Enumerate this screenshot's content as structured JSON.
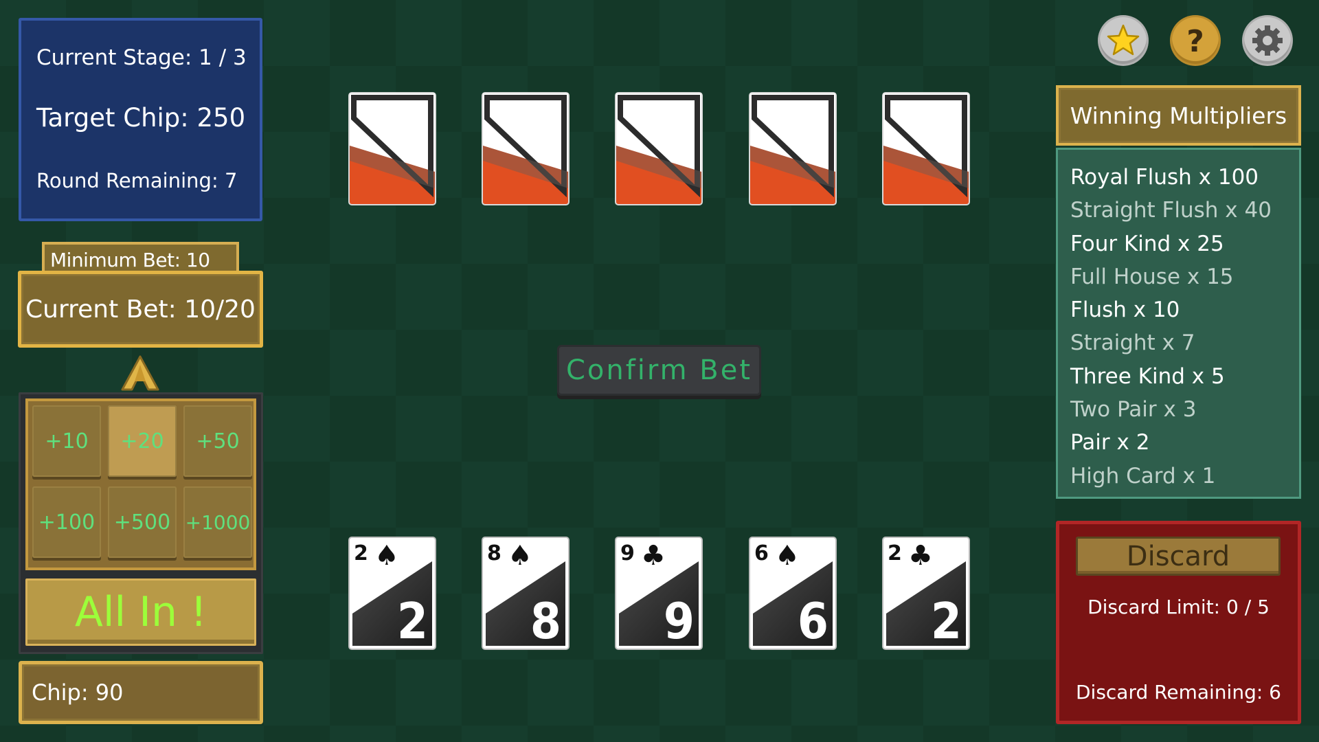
{
  "stage": {
    "current_stage": "Current Stage: 1 / 3",
    "target_chip": "Target Chip: 250",
    "round_remaining": "Round Remaining: 7"
  },
  "bet": {
    "minimum_bet": "Minimum Bet: 10",
    "current_bet": "Current Bet: 10/20",
    "chip_buttons": [
      "+10",
      "+20",
      "+50",
      "+100",
      "+500",
      "+1000"
    ],
    "selected_chip": "+20",
    "all_in": "All In !",
    "chip": "Chip: 90"
  },
  "confirm_bet": "Confirm Bet",
  "dealer_cards": [
    "face-down",
    "face-down",
    "face-down",
    "face-down",
    "face-down"
  ],
  "player_cards": [
    {
      "rank": "2",
      "suit": "spade"
    },
    {
      "rank": "8",
      "suit": "spade"
    },
    {
      "rank": "9",
      "suit": "club"
    },
    {
      "rank": "6",
      "suit": "spade"
    },
    {
      "rank": "2",
      "suit": "club"
    }
  ],
  "top_icons": [
    "star-icon",
    "help-icon",
    "gear-icon"
  ],
  "multipliers": {
    "title": "Winning Multipliers",
    "items": [
      "Royal Flush x 100",
      "Straight Flush x 40",
      "Four Kind x 25",
      "Full House x 15",
      "Flush x 10",
      "Straight x 7",
      "Three Kind x 5",
      "Two Pair x 3",
      "Pair x 2",
      "High Card x 1"
    ]
  },
  "discard": {
    "button": "Discard",
    "limit": "Discard Limit: 0 / 5",
    "remaining": "Discard Remaining: 6"
  },
  "colors": {
    "card_back_orange": "#e14f21",
    "accent_gold": "#dcb24d",
    "chip_text_green": "#5fe07e",
    "all_in_green": "#9cff3a",
    "confirm_text_green": "#33b26a"
  }
}
